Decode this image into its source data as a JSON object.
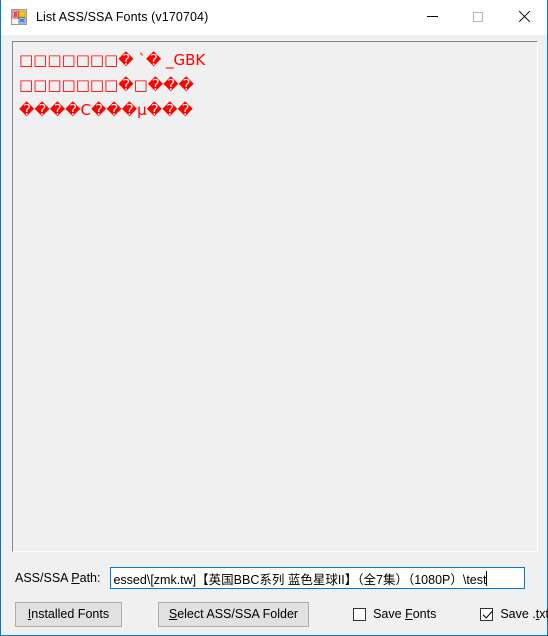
{
  "window": {
    "title": "List ASS/SSA Fonts (v170704)",
    "icon_name": "app-icon",
    "controls": {
      "minimize_label": "Minimize",
      "maximize_label": "Maximize",
      "close_label": "Close"
    },
    "border_color": "#0078d7",
    "titlebar_background": "#ffffff",
    "client_background": "#f0f0f0"
  },
  "font_list": {
    "text_color": "#ff0000",
    "background": "#f0f0f0",
    "lines": [
      "□□□□□□□� `� _GBK",
      "□□□□□□□�□���",
      "����C���µ���"
    ]
  },
  "path_field": {
    "label_prefix": "ASS/SSA ",
    "label_accel": "P",
    "label_suffix": "ath:",
    "value": "essed\\[zmk.tw]【英国BBC系列 蓝色星球II】（全7集）（1080P）\\test",
    "placeholder": "",
    "focus_color": "#0078d7"
  },
  "controls": {
    "installed_fonts_button": {
      "accel": "I",
      "rest": "nstalled Fonts"
    },
    "select_folder_button": {
      "accel": "S",
      "rest": "elect ASS/SSA Folder"
    },
    "save_fonts_checkbox": {
      "prefix": "Save ",
      "accel": "F",
      "suffix": "onts",
      "checked": false
    },
    "save_txt_checkbox": {
      "prefix": "Save .",
      "accel": "t",
      "suffix": "xt",
      "checked": true
    }
  }
}
